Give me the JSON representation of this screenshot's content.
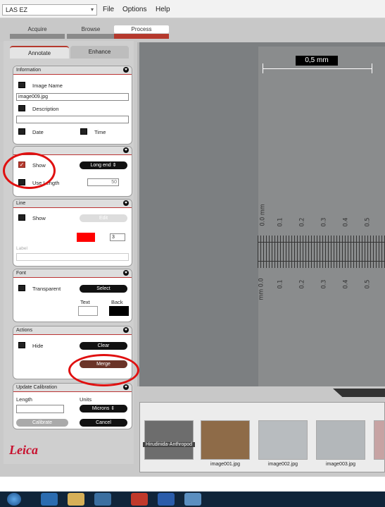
{
  "app": {
    "selector_value": "LAS EZ"
  },
  "menu": [
    "File",
    "Options",
    "Help"
  ],
  "workflow_tabs": [
    "Acquire",
    "Browse",
    "Process"
  ],
  "subtabs": [
    "Annotate",
    "Enhance"
  ],
  "information": {
    "header": "Information",
    "image_name_label": "Image Name",
    "image_name_value": "image009.jpg",
    "description_label": "Description",
    "description_value": "",
    "date_label": "Date",
    "time_label": "Time"
  },
  "scalebar": {
    "show_label": "Show",
    "style_value": "Long end",
    "length_label": "Use Length",
    "length_value": "50"
  },
  "line": {
    "header": "Line",
    "show_label": "Show",
    "mode_value": "Edit",
    "width_value": "3",
    "label_label": "Label"
  },
  "font": {
    "header": "Font",
    "transparent_label": "Transparent",
    "select_label": "Select",
    "text_label": "Text",
    "back_label": "Back"
  },
  "actions": {
    "header": "Actions",
    "hide_label": "Hide",
    "clear_label": "Clear",
    "merge_label": "Merge"
  },
  "calibration": {
    "header": "Update Calibration",
    "length_label": "Length",
    "units_label": "Units",
    "units_value": "Microns",
    "calibrate_label": "Calibrate",
    "cancel_label": "Cancel"
  },
  "brand": "Leica",
  "image": {
    "scale_text": "0,5 mm",
    "upper_ticks": [
      "0.0 mm",
      "0.1",
      "0.2",
      "0.3",
      "0.4",
      "0.5"
    ],
    "lower_ticks": [
      "mm 0.0",
      "0.1",
      "0.2",
      "0.3",
      "0.4",
      "0.5"
    ]
  },
  "thumbnails": [
    "Hirudinida-Anthropod",
    "image001.jpg",
    "image002.jpg",
    "image003.jpg"
  ],
  "colors": {
    "accent": "#b5392d",
    "merge_button": "#6b3428",
    "line_color": "#ff0000",
    "highlight_ring": "#e01010"
  }
}
